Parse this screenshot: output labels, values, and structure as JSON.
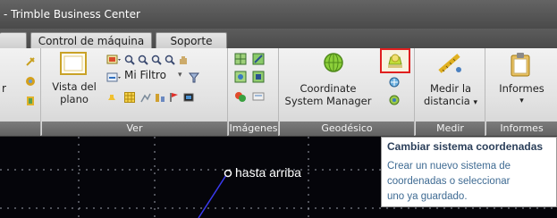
{
  "titlebar": {
    "title": "- Trimble Business Center"
  },
  "tabs": [
    {
      "label": "Control de máquina"
    },
    {
      "label": "Soporte"
    }
  ],
  "ribbon": {
    "ver": {
      "vista_label_1": "Vista del",
      "vista_label_2": "plano",
      "filter_label": "Mi Filtro",
      "group_label": "Ver"
    },
    "imagenes": {
      "group_label": "Imágenes"
    },
    "geodesico": {
      "csm_label_1": "Coordinate",
      "csm_label_2": "System Manager",
      "group_label": "Geodésico"
    },
    "medir": {
      "label_1": "Medir la",
      "label_2": "distancia",
      "dropdown_arrow": "▾",
      "group_label": "Medir"
    },
    "informes": {
      "label": "Informes",
      "dropdown_arrow": "▾",
      "group_label": "Informes"
    }
  },
  "tooltip": {
    "title": "Cambiar sistema coordenadas",
    "line1": "Crear un nuevo sistema de",
    "line2": "coordenadas o seleccionar",
    "line3": "uno ya guardado."
  },
  "canvas": {
    "point_label": "hasta arriba"
  },
  "colors": {
    "highlight_border": "#e02020",
    "canvas_bg": "#05050a",
    "tooltip_title": "#2b3f5a",
    "tooltip_text": "#3f6b93",
    "line_color": "#3a3af0"
  }
}
